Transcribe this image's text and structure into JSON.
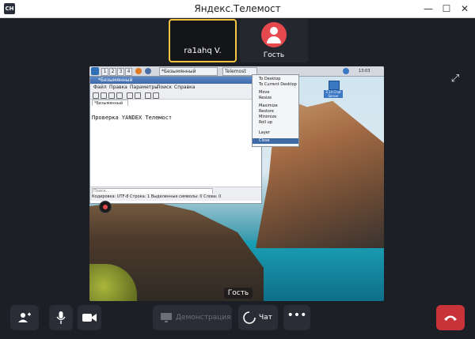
{
  "window": {
    "title": "Яндекс.Телемост",
    "app_icon_text": "СН",
    "minimize": "—",
    "maximize": "☐",
    "close": "✕"
  },
  "participants": [
    {
      "name": "ra1ahq V.",
      "active": true
    },
    {
      "name": "Гость",
      "avatar_color": "#e5484d"
    }
  ],
  "shared_screen": {
    "presenter": "Гость",
    "taskbar": {
      "workspaces": [
        "1",
        "2",
        "3",
        "4"
      ],
      "tasks": [
        "*Безымянный",
        "Telemost"
      ],
      "clock": "13:03"
    },
    "leafpad": {
      "title": "*Безымянный",
      "menu": [
        "Файл",
        "Правка",
        "Параметры",
        "Поиск",
        "Справка"
      ],
      "tab": "*Безымянный",
      "content": "Проверка YANDEX Телемост",
      "search_placeholder": "Поиск...",
      "status": "Кодировка: UTF-8  Строка: 1  Выделенные символы: 0  Слова: 0"
    },
    "context_menu": [
      "To Desktop",
      "To Current Desktop",
      "Move",
      "Resize",
      "Maximize",
      "Restore",
      "Minimize",
      "Roll up",
      "Layer",
      "Close"
    ],
    "context_menu_highlight": "Close",
    "desktop_icon_label": "3.14 Chat Server"
  },
  "controls": {
    "add_participant": "add-person",
    "mic": "mic",
    "camera": "camera",
    "demo_label": "Демонстрация",
    "chat_label": "Чат",
    "more": "•••",
    "hangup": "hang-up",
    "hangup_color": "#c8333a"
  },
  "accent_color": "#f5c542"
}
